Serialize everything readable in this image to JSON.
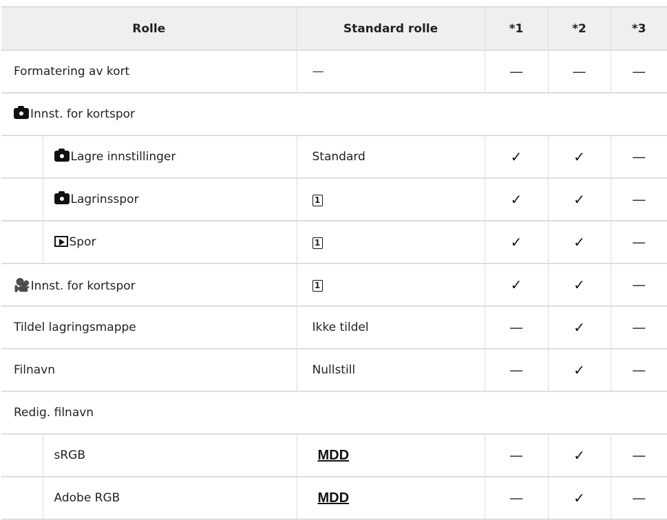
{
  "header": {
    "role": "Rolle",
    "default": "Standard rolle",
    "c1": "*1",
    "c2": "*2",
    "c3": "*3"
  },
  "symbols": {
    "dash": "—",
    "check": "✓",
    "slot": "1",
    "movie": "🎥"
  },
  "icons": {
    "camera": "camera-icon",
    "playback": "playback-icon",
    "movie": "movie-icon",
    "slot": "card-slot-1-icon"
  },
  "rows": {
    "r0": {
      "label": "Formatering av kort",
      "default": "—",
      "c1": "—",
      "c2": "—",
      "c3": "—"
    },
    "r1": {
      "label": "Innst. for kortspor"
    },
    "r2": {
      "label": "Lagre innstillinger",
      "default": "Standard",
      "c1": "✓",
      "c2": "✓",
      "c3": "—"
    },
    "r3": {
      "label": "Lagrinsspor",
      "c1": "✓",
      "c2": "✓",
      "c3": "—"
    },
    "r4": {
      "label": "Spor",
      "c1": "✓",
      "c2": "✓",
      "c3": "—"
    },
    "r5": {
      "label": "Innst. for kortspor",
      "c1": "✓",
      "c2": "✓",
      "c3": "—"
    },
    "r6": {
      "label": "Tildel lagringsmappe",
      "default": "Ikke tildel",
      "c1": "—",
      "c2": "✓",
      "c3": "—"
    },
    "r7": {
      "label": "Filnavn",
      "default": "Nullstill",
      "c1": "—",
      "c2": "✓",
      "c3": "—"
    },
    "r8": {
      "label": "Redig. filnavn"
    },
    "r9": {
      "label": "sRGB",
      "default": "MDD",
      "c1": "—",
      "c2": "✓",
      "c3": "—"
    },
    "r10": {
      "label": "Adobe RGB",
      "default": "MDD",
      "c1": "—",
      "c2": "✓",
      "c3": "—"
    }
  }
}
